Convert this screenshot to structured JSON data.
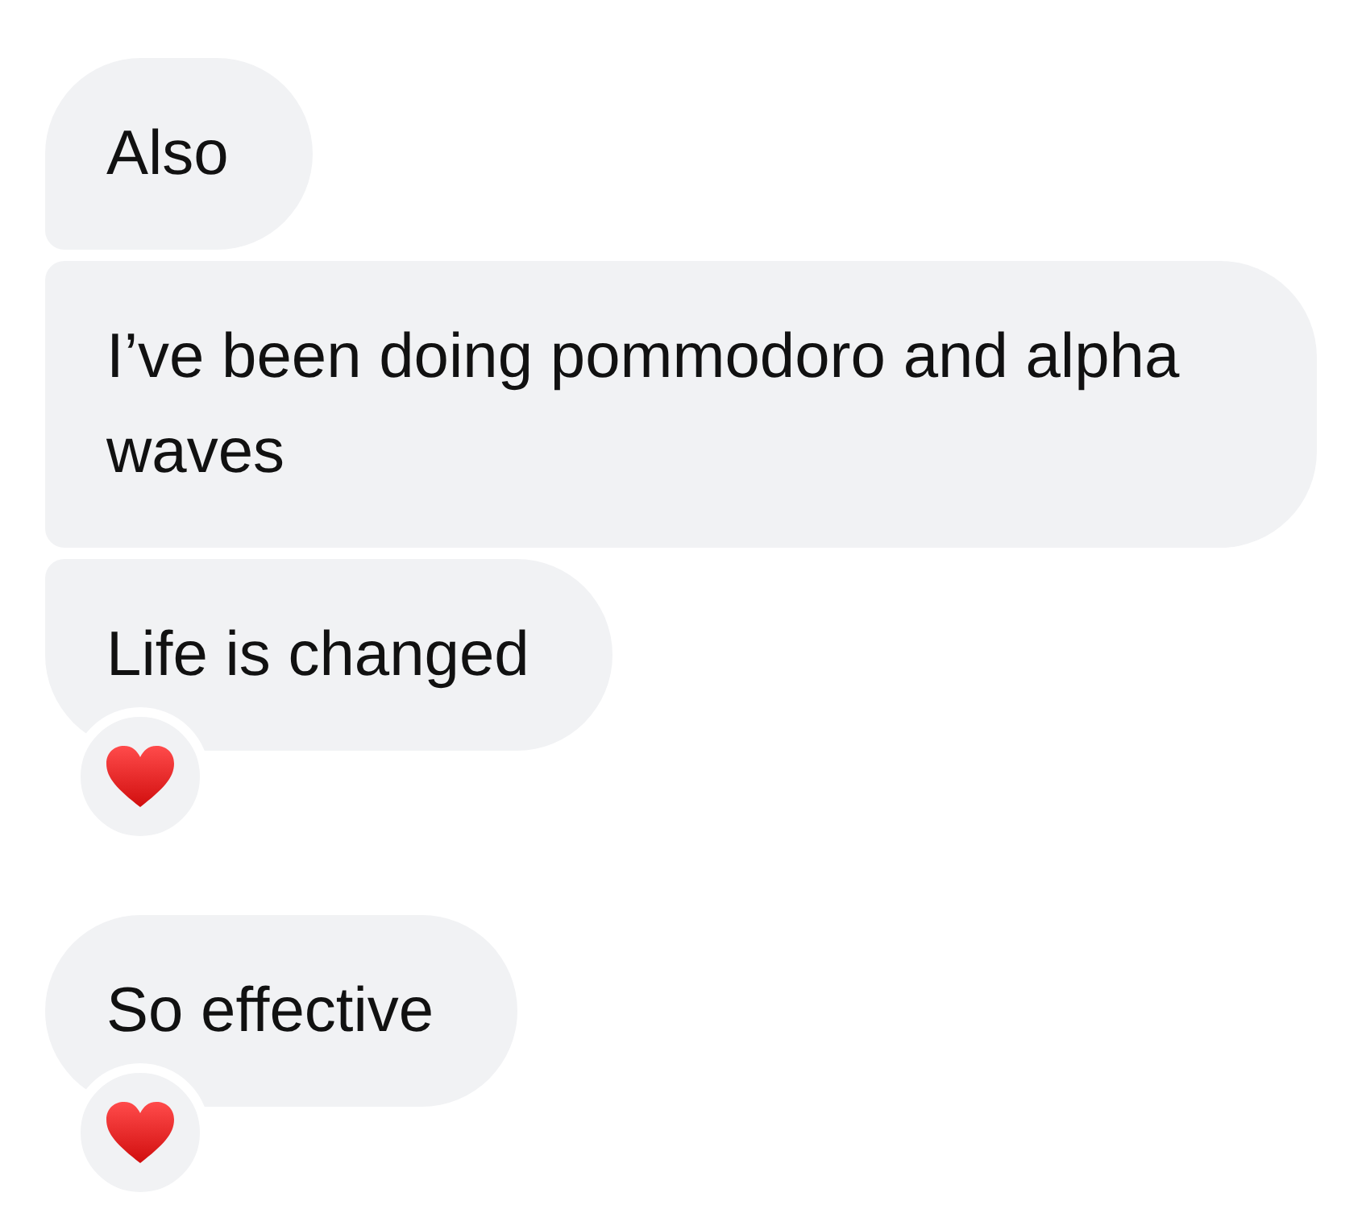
{
  "groups": [
    {
      "messages": [
        {
          "text": "Also",
          "reacted": false
        },
        {
          "text": "I’ve been doing pommodoro and alpha waves",
          "reacted": false
        },
        {
          "text": "Life is changed",
          "reacted": true
        }
      ]
    },
    {
      "messages": [
        {
          "text": "So effective",
          "reacted": true
        }
      ]
    }
  ]
}
